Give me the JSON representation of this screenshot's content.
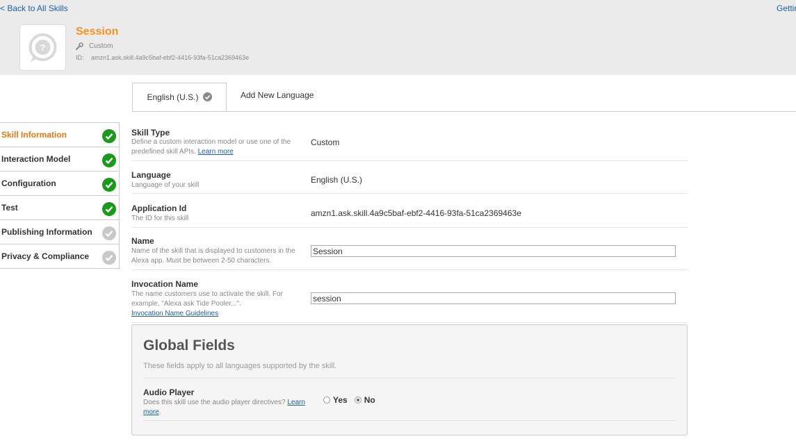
{
  "header": {
    "back_link": "< Back to All Skills",
    "getting_started": "Getting Started",
    "skill_name": "Session",
    "skill_type": "Custom",
    "id_label": "ID:",
    "skill_id": "amzn1.ask.skill.4a9c5baf-ebf2-4416-93fa-51ca2369463e",
    "icon_glyph": "?"
  },
  "tabs": {
    "active": "English (U.S.)",
    "add": "Add New Language"
  },
  "sidebar": {
    "items": [
      {
        "label": "Skill Information",
        "status": "complete",
        "active": true
      },
      {
        "label": "Interaction Model",
        "status": "complete",
        "active": false
      },
      {
        "label": "Configuration",
        "status": "complete",
        "active": false
      },
      {
        "label": "Test",
        "status": "complete",
        "active": false
      },
      {
        "label": "Publishing Information",
        "status": "incomplete",
        "active": false
      },
      {
        "label": "Privacy & Compliance",
        "status": "incomplete",
        "active": false
      }
    ]
  },
  "form": {
    "skill_type": {
      "title": "Skill Type",
      "desc": "Define a custom interaction model or use one of the predefined skill APIs.",
      "link": "Learn more",
      "value": "Custom"
    },
    "language": {
      "title": "Language",
      "desc": "Language of your skill",
      "value": "English (U.S.)"
    },
    "application_id": {
      "title": "Application Id",
      "desc": "The ID for this skill",
      "value": "amzn1.ask.skill.4a9c5baf-ebf2-4416-93fa-51ca2369463e"
    },
    "name": {
      "title": "Name",
      "desc": "Name of the skill that is displayed to customers in the Alexa app. Must be between 2-50 characters.",
      "value": "Session"
    },
    "invocation_name": {
      "title": "Invocation Name",
      "desc": "The name customers use to activate the skill. For example, \"Alexa ask Tide Pooler...\".",
      "link": "Invocation Name Guidelines",
      "value": "session"
    }
  },
  "global_fields": {
    "title": "Global Fields",
    "subtitle": "These fields apply to all languages supported by the skill.",
    "audio_player": {
      "title": "Audio Player",
      "desc": "Does this skill use the audio player directives?",
      "link": "Learn more",
      "period": ".",
      "options": [
        "Yes",
        "No"
      ],
      "selected": "No"
    }
  },
  "colors": {
    "accent": "#f5931f",
    "check_green": "#1a9a1a",
    "check_grey": "#c8c8c8",
    "link": "#1a5fa8"
  }
}
